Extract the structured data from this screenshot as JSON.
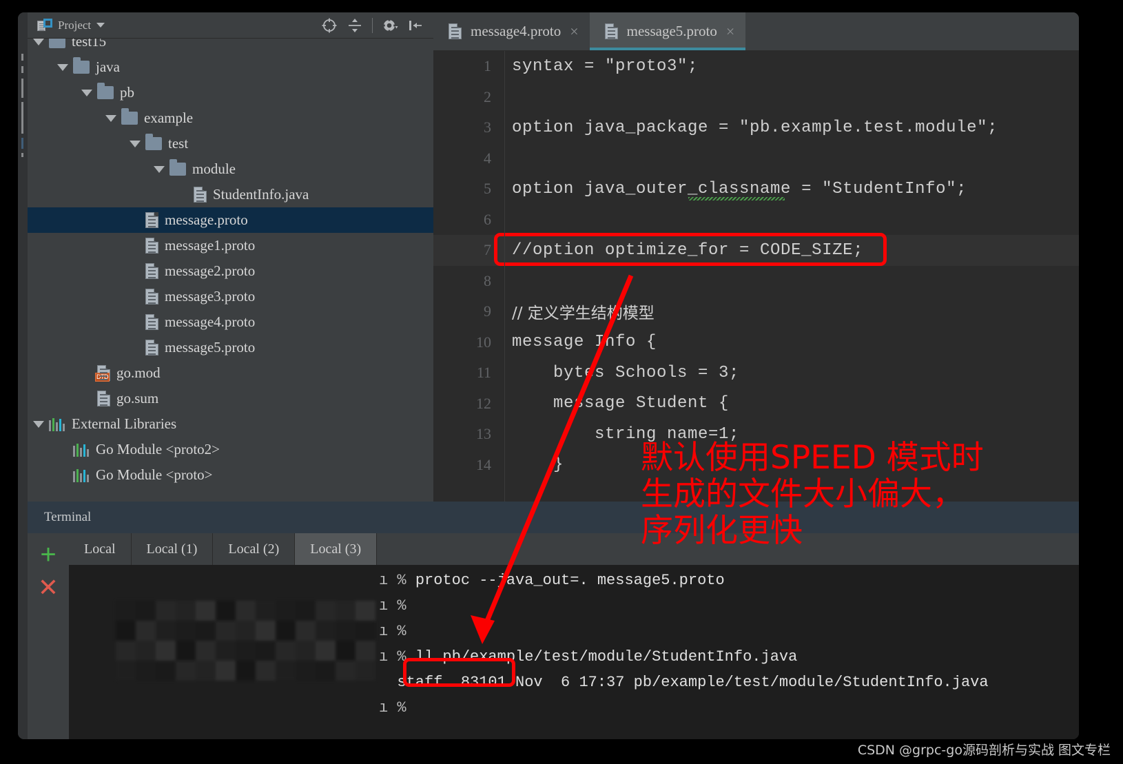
{
  "window": {
    "project_tool": {
      "title": "Project",
      "icons": [
        "locate-icon",
        "collapse-all-icon",
        "settings-gear-icon",
        "hide-panel-icon"
      ]
    }
  },
  "sidebar": {
    "items": [
      {
        "label": "test15",
        "depth": 1,
        "type": "folder",
        "expanded": true,
        "selected": false,
        "clipped": true
      },
      {
        "label": "java",
        "depth": 2,
        "type": "folder",
        "expanded": true,
        "selected": false
      },
      {
        "label": "pb",
        "depth": 3,
        "type": "folder",
        "expanded": true,
        "selected": false
      },
      {
        "label": "example",
        "depth": 4,
        "type": "folder",
        "expanded": true,
        "selected": false
      },
      {
        "label": "test",
        "depth": 5,
        "type": "folder",
        "expanded": true,
        "selected": false
      },
      {
        "label": "module",
        "depth": 6,
        "type": "folder",
        "expanded": true,
        "selected": false
      },
      {
        "label": "StudentInfo.java",
        "depth": 7,
        "type": "file",
        "selected": false
      },
      {
        "label": "message.proto",
        "depth": 5,
        "type": "file",
        "selected": true
      },
      {
        "label": "message1.proto",
        "depth": 5,
        "type": "file",
        "selected": false
      },
      {
        "label": "message2.proto",
        "depth": 5,
        "type": "file",
        "selected": false
      },
      {
        "label": "message3.proto",
        "depth": 5,
        "type": "file",
        "selected": false
      },
      {
        "label": "message4.proto",
        "depth": 5,
        "type": "file",
        "selected": false
      },
      {
        "label": "message5.proto",
        "depth": 5,
        "type": "file",
        "selected": false
      },
      {
        "label": "go.mod",
        "depth": 3,
        "type": "file-dtd",
        "selected": false
      },
      {
        "label": "go.sum",
        "depth": 3,
        "type": "file",
        "selected": false
      },
      {
        "label": "External Libraries",
        "depth": 1,
        "type": "lib",
        "expanded": true,
        "selected": false
      },
      {
        "label": "Go Module <proto2>",
        "depth": 2,
        "type": "lib",
        "selected": false
      },
      {
        "label": "Go Module <proto>",
        "depth": 2,
        "type": "lib",
        "selected": false,
        "clipped": true
      }
    ]
  },
  "editor": {
    "tabs": [
      {
        "label": "message4.proto",
        "active": false,
        "close": "×"
      },
      {
        "label": "message5.proto",
        "active": true,
        "close": "×"
      }
    ],
    "lines": [
      {
        "n": "1",
        "text": "syntax = \"proto3\";",
        "highlight": false
      },
      {
        "n": "2",
        "text": "",
        "highlight": false
      },
      {
        "n": "3",
        "text": "option java_package = \"pb.example.test.module\";",
        "highlight": false
      },
      {
        "n": "4",
        "text": "",
        "highlight": false
      },
      {
        "n": "5",
        "text": "option java_outer_classname = \"StudentInfo\";",
        "highlight": false,
        "squiggle": true
      },
      {
        "n": "6",
        "text": "",
        "highlight": false
      },
      {
        "n": "7",
        "text": "//option optimize_for = CODE_SIZE;",
        "highlight": true,
        "boxed": true
      },
      {
        "n": "8",
        "text": "",
        "highlight": false
      },
      {
        "n": "9",
        "text": "// 定义学生结构模型",
        "highlight": false,
        "cjk": true
      },
      {
        "n": "10",
        "text": "message Info {",
        "highlight": false
      },
      {
        "n": "11",
        "text": "    bytes Schools = 3;",
        "highlight": false
      },
      {
        "n": "12",
        "text": "    message Student {",
        "highlight": false
      },
      {
        "n": "13",
        "text": "        string name=1;",
        "highlight": false
      },
      {
        "n": "14",
        "text": "    }",
        "highlight": false
      }
    ]
  },
  "terminal": {
    "header": "Terminal",
    "add_icon": "+",
    "close_icon": "✕",
    "tabs": [
      {
        "label": "Local",
        "active": false
      },
      {
        "label": "Local (1)",
        "active": false
      },
      {
        "label": "Local (2)",
        "active": false
      },
      {
        "label": "Local (3)",
        "active": true
      }
    ],
    "output": [
      {
        "prefix": "ı % ",
        "text": "protoc --java_out=. message5.proto"
      },
      {
        "prefix": "ı % ",
        "text": ""
      },
      {
        "prefix": "ı % ",
        "text": ""
      },
      {
        "prefix": "ı % ",
        "text": "ll pb/example/test/module/StudentInfo.java"
      },
      {
        "prefix": "",
        "text": "  staff  83101 Nov  6 17:37 pb/example/test/module/StudentInfo.java"
      },
      {
        "prefix": "ı % ",
        "text": ""
      }
    ],
    "highlighted_value": "83101 Nov"
  },
  "annotations": {
    "note": "默认使用SPEED 模式时\n生成的文件大小偏大，\n序列化更快",
    "color": "#fb0000"
  },
  "watermark": "CSDN @grpc-go源码剖析与实战 图文专栏",
  "colors": {
    "panel_bg": "#3c3f41",
    "editor_bg": "#2b2b2b",
    "selection": "#0d2b45",
    "terminal_header": "#2f3a45",
    "accent": "#3d8b9e",
    "annotation_red": "#fb0000"
  }
}
